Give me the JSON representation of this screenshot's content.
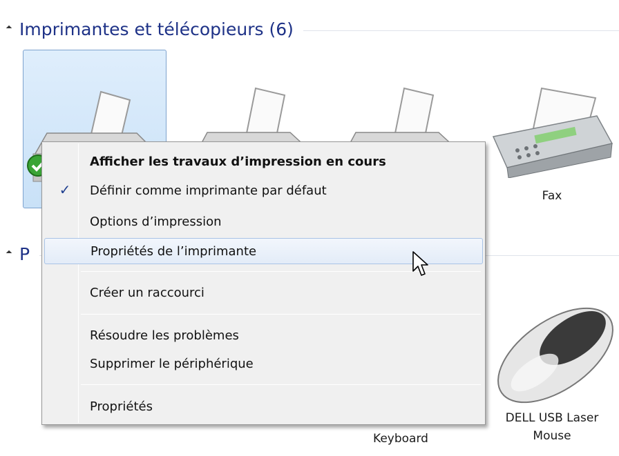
{
  "groups": {
    "printers": {
      "title": "Imprimantes et télécopieurs (6)"
    },
    "peripherals": {
      "title": "P"
    }
  },
  "devices": {
    "fax": {
      "label": "Fax",
      "icon": "fax-machine-icon"
    },
    "keyboard": {
      "label": "Keyboard",
      "icon": "keyboard-icon"
    },
    "mouse": {
      "label_line1": "DELL USB Laser",
      "label_line2": "Mouse",
      "icon": "mouse-icon"
    }
  },
  "context_menu": {
    "items": [
      {
        "label": "Afficher les travaux d’impression en cours",
        "bold": true
      },
      {
        "label": "Définir comme imprimante par défaut",
        "checked": true
      },
      {
        "label": "Options d’impression"
      },
      {
        "label": "Propriétés de l’imprimante",
        "highlighted": true
      },
      {
        "label": "Créer un raccourci"
      },
      {
        "label": "Résoudre les problèmes"
      },
      {
        "label": "Supprimer le périphérique"
      },
      {
        "label": "Propriétés"
      }
    ],
    "check_glyph": "✓"
  },
  "colors": {
    "header_text": "#1e3287",
    "selection_fill": "#cfe4f8",
    "menu_bg": "#f0f0f0",
    "menu_hover_border": "#a8c3e6"
  }
}
